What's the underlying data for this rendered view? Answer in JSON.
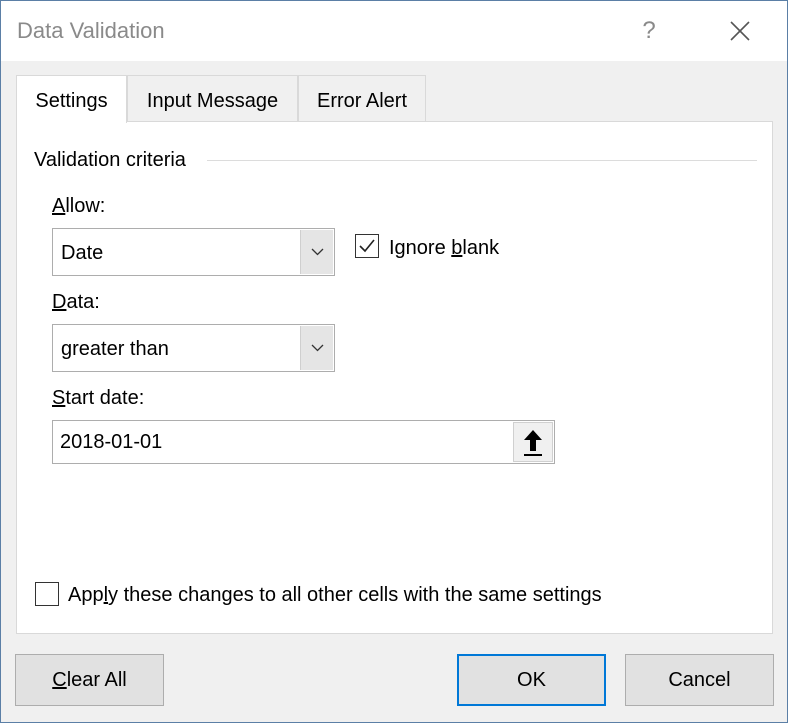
{
  "window": {
    "title": "Data Validation",
    "help_symbol": "?",
    "close_icon": "close-icon"
  },
  "tabs": [
    {
      "label": "Settings",
      "active": true
    },
    {
      "label": "Input Message",
      "active": false
    },
    {
      "label": "Error Alert",
      "active": false
    }
  ],
  "criteria": {
    "group_label": "Validation criteria",
    "allow": {
      "label_prefix": "",
      "label_key": "A",
      "label_rest": "llow:",
      "value": "Date"
    },
    "ignore_blank": {
      "label_pre": "Ignore ",
      "label_key": "b",
      "label_rest": "lank",
      "checked": true
    },
    "data": {
      "label_key": "D",
      "label_rest": "ata:",
      "value": "greater than"
    },
    "start_date": {
      "label_key": "S",
      "label_rest": "tart date:",
      "value": "2018-01-01",
      "ref_icon": "collapse-arrow-up-icon"
    }
  },
  "apply_all": {
    "label_pre": "App",
    "label_key": "l",
    "label_rest": "y these changes to all other cells with the same settings",
    "checked": false
  },
  "buttons": {
    "clear_key": "C",
    "clear_rest": "lear All",
    "ok": "OK",
    "cancel": "Cancel"
  }
}
